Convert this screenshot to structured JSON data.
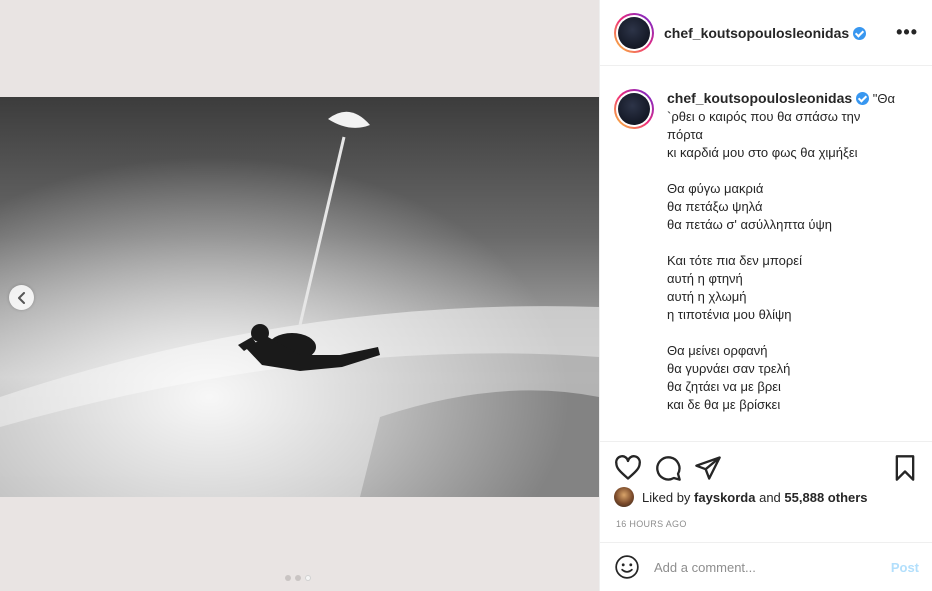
{
  "post": {
    "username": "chef_koutsopoulosleonidas",
    "more_label": "•••",
    "caption_lines": [
      "\"Θα",
      "`ρθει ο καιρός που θα σπάσω την",
      "πόρτα",
      "κι καρδιά μου στο φως θα χιμήξει",
      "",
      "Θα φύγω μακριά",
      "θα πετάξω ψηλά",
      "θα πετάω σ' ασύλληπτα ύψη",
      "",
      "Και τότε πια δεν μπορεί",
      "αυτή η φτηνή",
      "αυτή η χλωμή",
      "η τιποτένια μου θλίψη",
      "",
      "Θα μείνει ορφανή",
      "θα γυρνάει σαν τρελή",
      "θα ζητάει να με βρει",
      "και δε θα με βρίσκει"
    ],
    "likes": {
      "prefix": "Liked by",
      "user": "fayskorda",
      "joiner": "and",
      "count": "55,888 others"
    },
    "timestamp": "16 HOURS AGO",
    "comment_placeholder": "Add a comment...",
    "post_label": "Post"
  },
  "media": {
    "slide_count": 3,
    "active_slide": 3
  },
  "icons": {
    "prev": "chevron-left-icon",
    "like": "heart-icon",
    "comment": "comment-icon",
    "share": "paper-plane-icon",
    "save": "bookmark-icon",
    "emoji": "smiley-icon",
    "verified": "verified-badge-icon"
  },
  "colors": {
    "verified": "#3897f0",
    "post_button": "#b2dffc",
    "media_background": "#e9e4e3"
  }
}
